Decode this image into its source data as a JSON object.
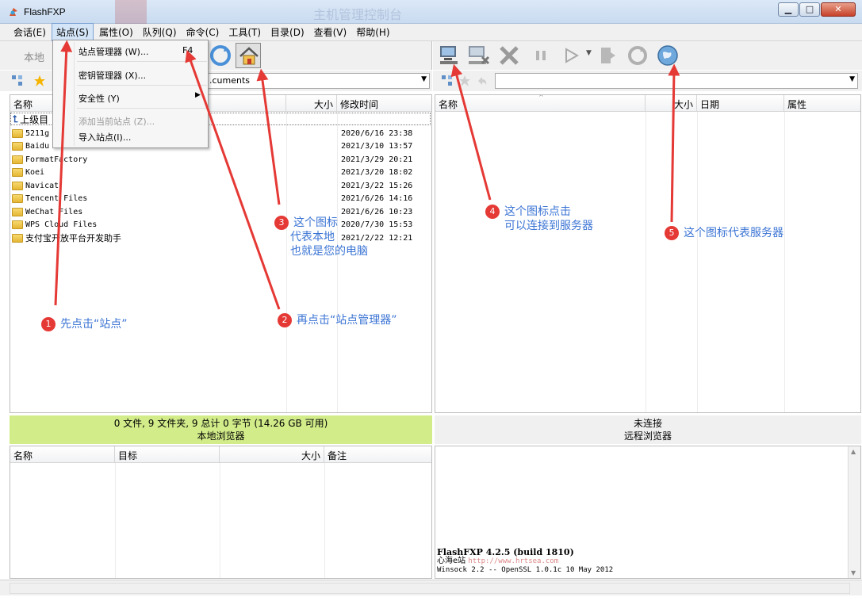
{
  "window": {
    "title": "FlashFXP",
    "watermark_text": "主机管理控制台"
  },
  "menubar": [
    "会话(E)",
    "站点(S)",
    "属性(O)",
    "队列(Q)",
    "命令(C)",
    "工具(T)",
    "目录(D)",
    "查看(V)",
    "帮助(H)"
  ],
  "dropdown": {
    "site_manager": "站点管理器 (W)...",
    "site_manager_shortcut": "F4",
    "key_manager": "密钥管理器 (X)...",
    "security": "安全性 (Y)",
    "add_current": "添加当前站点 (Z)...",
    "import_sites": "导入站点(I)..."
  },
  "left": {
    "local_label": "本地",
    "path": "...cuments",
    "columns": {
      "name": "名称",
      "size": "大小",
      "modified": "修改时间"
    },
    "up_label": "上级目",
    "files": [
      {
        "name": "5211g",
        "date": "2020/6/16 23:38"
      },
      {
        "name": "Baidu",
        "date": "2021/3/10 13:57"
      },
      {
        "name": "FormatFactory",
        "date": "2021/3/29 20:21"
      },
      {
        "name": "Koei",
        "date": "2021/3/20 18:02"
      },
      {
        "name": "Navicat",
        "date": "2021/3/22 15:26"
      },
      {
        "name": "Tencent Files",
        "date": "2021/6/26 14:16"
      },
      {
        "name": "WeChat Files",
        "date": "2021/6/26 10:23"
      },
      {
        "name": "WPS Cloud Files",
        "date": "2020/7/30 15:53"
      },
      {
        "name": "支付宝开放平台开发助手",
        "date": "2021/2/22 12:21"
      }
    ],
    "status_line1": "0 文件, 9 文件夹, 9 总计 0 字节 (14.26 GB 可用)",
    "status_line2": "本地浏览器"
  },
  "right": {
    "path": "",
    "columns": {
      "name": "名称",
      "size": "大小",
      "date": "日期",
      "attr": "属性"
    },
    "status_line1": "未连接",
    "status_line2": "远程浏览器"
  },
  "queue": {
    "columns": {
      "name": "名称",
      "target": "目标",
      "size": "大小",
      "note": "备注"
    }
  },
  "log": {
    "line1": "FlashFXP 4.2.5 (build 1810)",
    "line2_prefix": "心海e站 ",
    "line2_url": "http://www.hrtsea.com",
    "line3": "Winsock 2.2 -- OpenSSL 1.0.1c 10 May 2012"
  },
  "annotations": {
    "a1": {
      "num": "1",
      "text": "先点击“站点”"
    },
    "a2": {
      "num": "2",
      "text": "再点击“站点管理器”"
    },
    "a3": {
      "num": "3",
      "line1": "这个图标",
      "line2": "代表本地",
      "line3": "也就是您的电脑"
    },
    "a4": {
      "num": "4",
      "line1": "这个图标点击",
      "line2": "可以连接到服务器"
    },
    "a5": {
      "num": "5",
      "text": "这个图标代表服务器"
    }
  },
  "colors": {
    "accent": "#3b74d4",
    "arrow": "#e53935",
    "status_local_bg": "#d2ec8a"
  }
}
